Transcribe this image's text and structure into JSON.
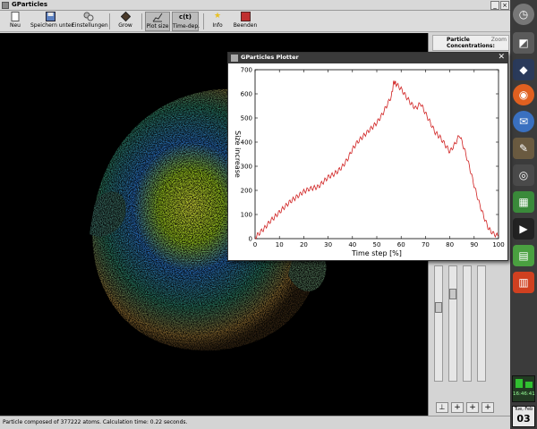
{
  "window": {
    "title": "GParticles"
  },
  "toolbar": {
    "items": [
      {
        "label": "Neu",
        "icon": "new-file-icon"
      },
      {
        "label": "Speichern unter",
        "icon": "save-icon"
      },
      {
        "label": "Einstellungen",
        "icon": "settings-icon"
      },
      {
        "label": "Grow",
        "icon": "grow-icon"
      },
      {
        "label": "Plot size",
        "icon": "plot-size-icon"
      },
      {
        "label": "Time-dep.",
        "icon": "c-of-t-icon",
        "icon_text": "c(t)"
      },
      {
        "label": "Info",
        "icon": "info-star-icon"
      },
      {
        "label": "Beenden",
        "icon": "quit-icon"
      }
    ]
  },
  "right_panel": {
    "header": "Particle Concentrations:",
    "zoom_label": "Zoom",
    "bottom_buttons": [
      "⊥",
      "+",
      "+",
      "+"
    ]
  },
  "status": {
    "text": "Particle composed of 377222 atoms. Calculation time: 0.22 seconds."
  },
  "plotter": {
    "title": "GParticles Plotter",
    "close_symbol": "✕"
  },
  "taskbar": {
    "clock_time": "16:46:41",
    "clock_day": "Tue, Feb",
    "clock_date": "03",
    "launchers": [
      "clock-icon",
      "network-icon",
      "firefox-icon",
      "thunderbird-icon",
      "gimp-icon",
      "camera-icon",
      "windows-icon",
      "video-icon",
      "spreadsheet-icon",
      "presentation-icon"
    ]
  },
  "colors": {
    "plot_line": "#d02020",
    "titlebar_dark": "#3a3a3a"
  },
  "chart_data": {
    "type": "line",
    "xlabel": "Time step [%]",
    "ylabel": "Size increase",
    "xlim": [
      0,
      100
    ],
    "ylim": [
      0,
      700
    ],
    "xticks": [
      0,
      10,
      20,
      30,
      40,
      50,
      60,
      70,
      80,
      90,
      100
    ],
    "yticks": [
      0,
      100,
      200,
      300,
      400,
      500,
      600,
      700
    ],
    "series": [
      {
        "x": [
          0,
          2,
          4,
          6,
          8,
          10,
          12,
          14,
          16,
          18,
          20,
          22,
          24,
          26,
          28,
          30,
          32,
          34,
          36,
          38,
          40,
          42,
          44,
          46,
          48,
          50,
          52,
          54,
          56,
          57,
          58,
          60,
          62,
          64,
          66,
          68,
          70,
          72,
          74,
          76,
          78,
          80,
          82,
          84,
          86,
          88,
          90,
          92,
          94,
          96,
          98,
          100
        ],
        "y": [
          5,
          25,
          45,
          70,
          90,
          110,
          130,
          150,
          165,
          180,
          195,
          205,
          210,
          215,
          235,
          255,
          265,
          280,
          300,
          330,
          370,
          400,
          420,
          440,
          460,
          480,
          510,
          550,
          590,
          650,
          640,
          620,
          590,
          560,
          540,
          560,
          520,
          480,
          440,
          420,
          390,
          360,
          390,
          430,
          370,
          300,
          220,
          150,
          90,
          40,
          20,
          10
        ]
      }
    ]
  }
}
